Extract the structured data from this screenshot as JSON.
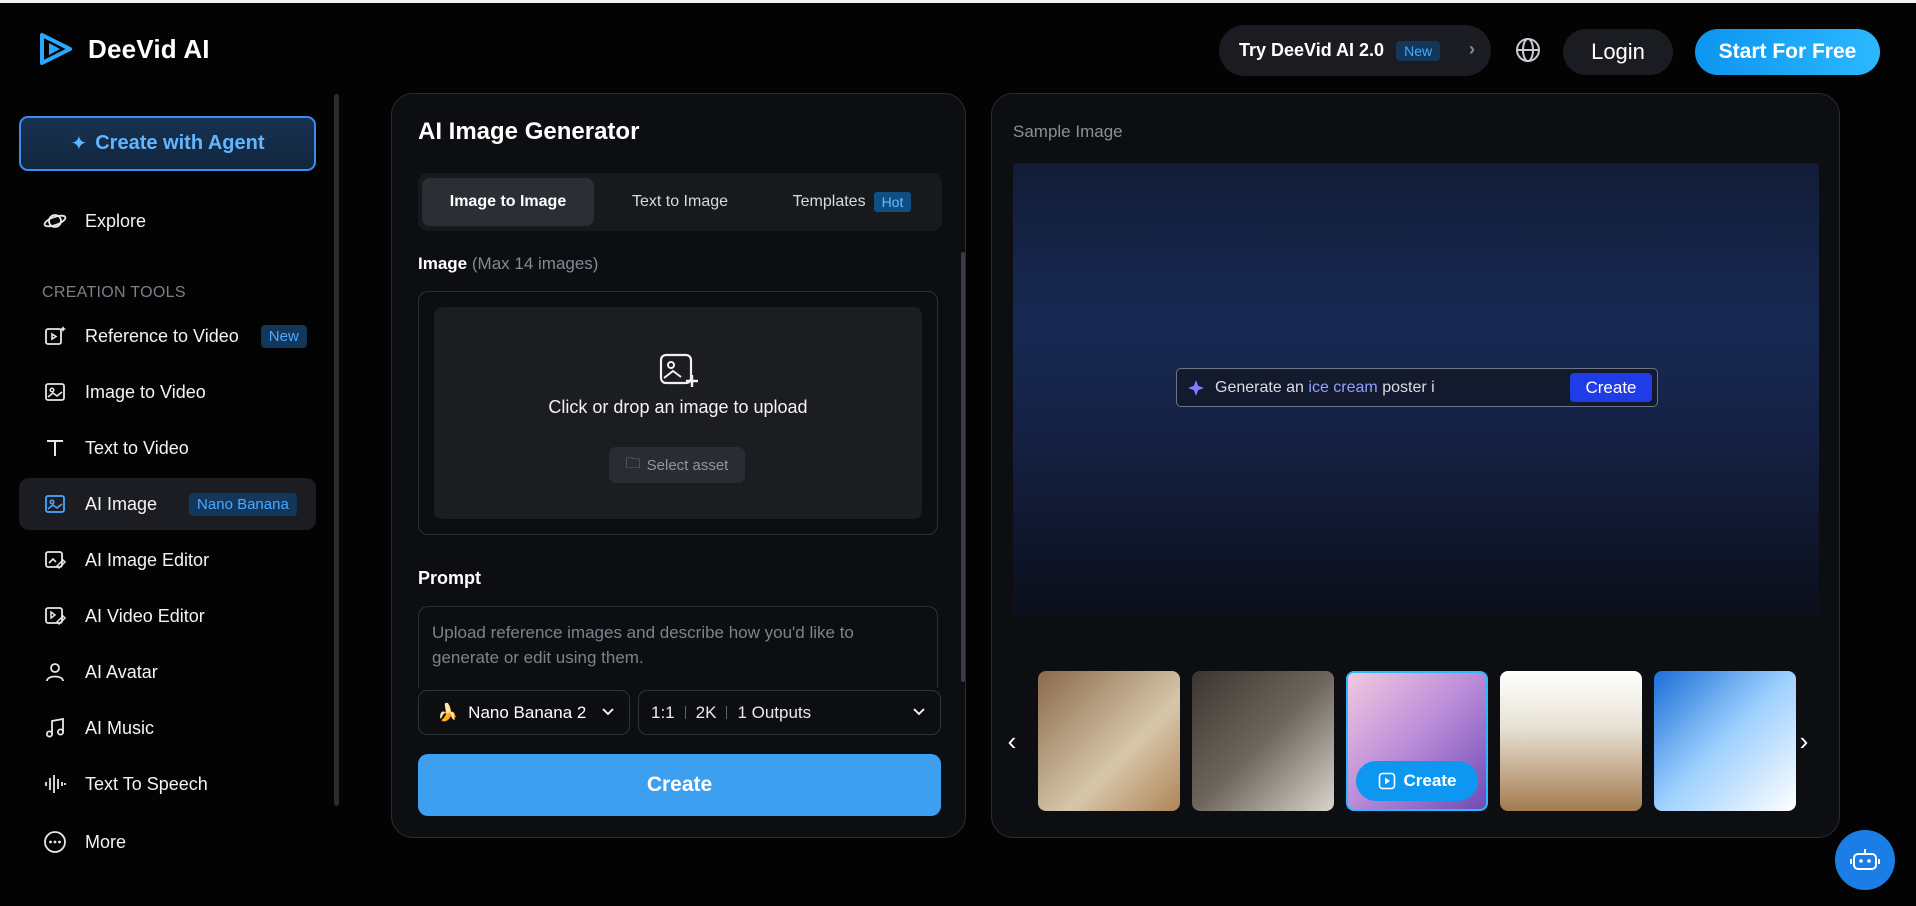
{
  "brand": {
    "name": "DeeVid AI"
  },
  "header": {
    "try_label": "Try DeeVid AI 2.0",
    "try_badge": "New",
    "login": "Login",
    "start": "Start For Free"
  },
  "sidebar": {
    "agent_button": "Create with Agent",
    "explore": "Explore",
    "section_label": "CREATION TOOLS",
    "items": [
      {
        "label": "Reference to Video",
        "badge": "New"
      },
      {
        "label": "Image to Video",
        "badge": ""
      },
      {
        "label": "Text to Video",
        "badge": ""
      },
      {
        "label": "AI Image",
        "badge": "Nano Banana"
      },
      {
        "label": "AI Image Editor",
        "badge": ""
      },
      {
        "label": "AI Video Editor",
        "badge": ""
      },
      {
        "label": "AI Avatar",
        "badge": ""
      },
      {
        "label": "AI Music",
        "badge": ""
      },
      {
        "label": "Text To Speech",
        "badge": ""
      },
      {
        "label": "More",
        "badge": ""
      }
    ]
  },
  "generator": {
    "title": "AI Image Generator",
    "tabs": [
      {
        "label": "Image to Image"
      },
      {
        "label": "Text to Image"
      },
      {
        "label": "Templates",
        "badge": "Hot"
      }
    ],
    "image_label": "Image",
    "image_hint": "(Max 14 images)",
    "upload_text": "Click or drop an image to upload",
    "select_asset": "Select asset",
    "prompt_label": "Prompt",
    "prompt_placeholder": "Upload reference images and describe how you'd like to generate or edit using them.",
    "model": "Nano Banana 2",
    "ratio": "1:1",
    "resolution": "2K",
    "outputs": "1 Outputs",
    "create": "Create"
  },
  "sample": {
    "label": "Sample Image",
    "prompt_prefix": "Generate an ",
    "prompt_highlight": "ice cream",
    "prompt_suffix": " poster i",
    "create": "Create",
    "thumb_button": "Create"
  },
  "colors": {
    "accent": "#2bb8ff",
    "create_button": "#3d9ff0",
    "badge_text": "#4aa9ff"
  }
}
